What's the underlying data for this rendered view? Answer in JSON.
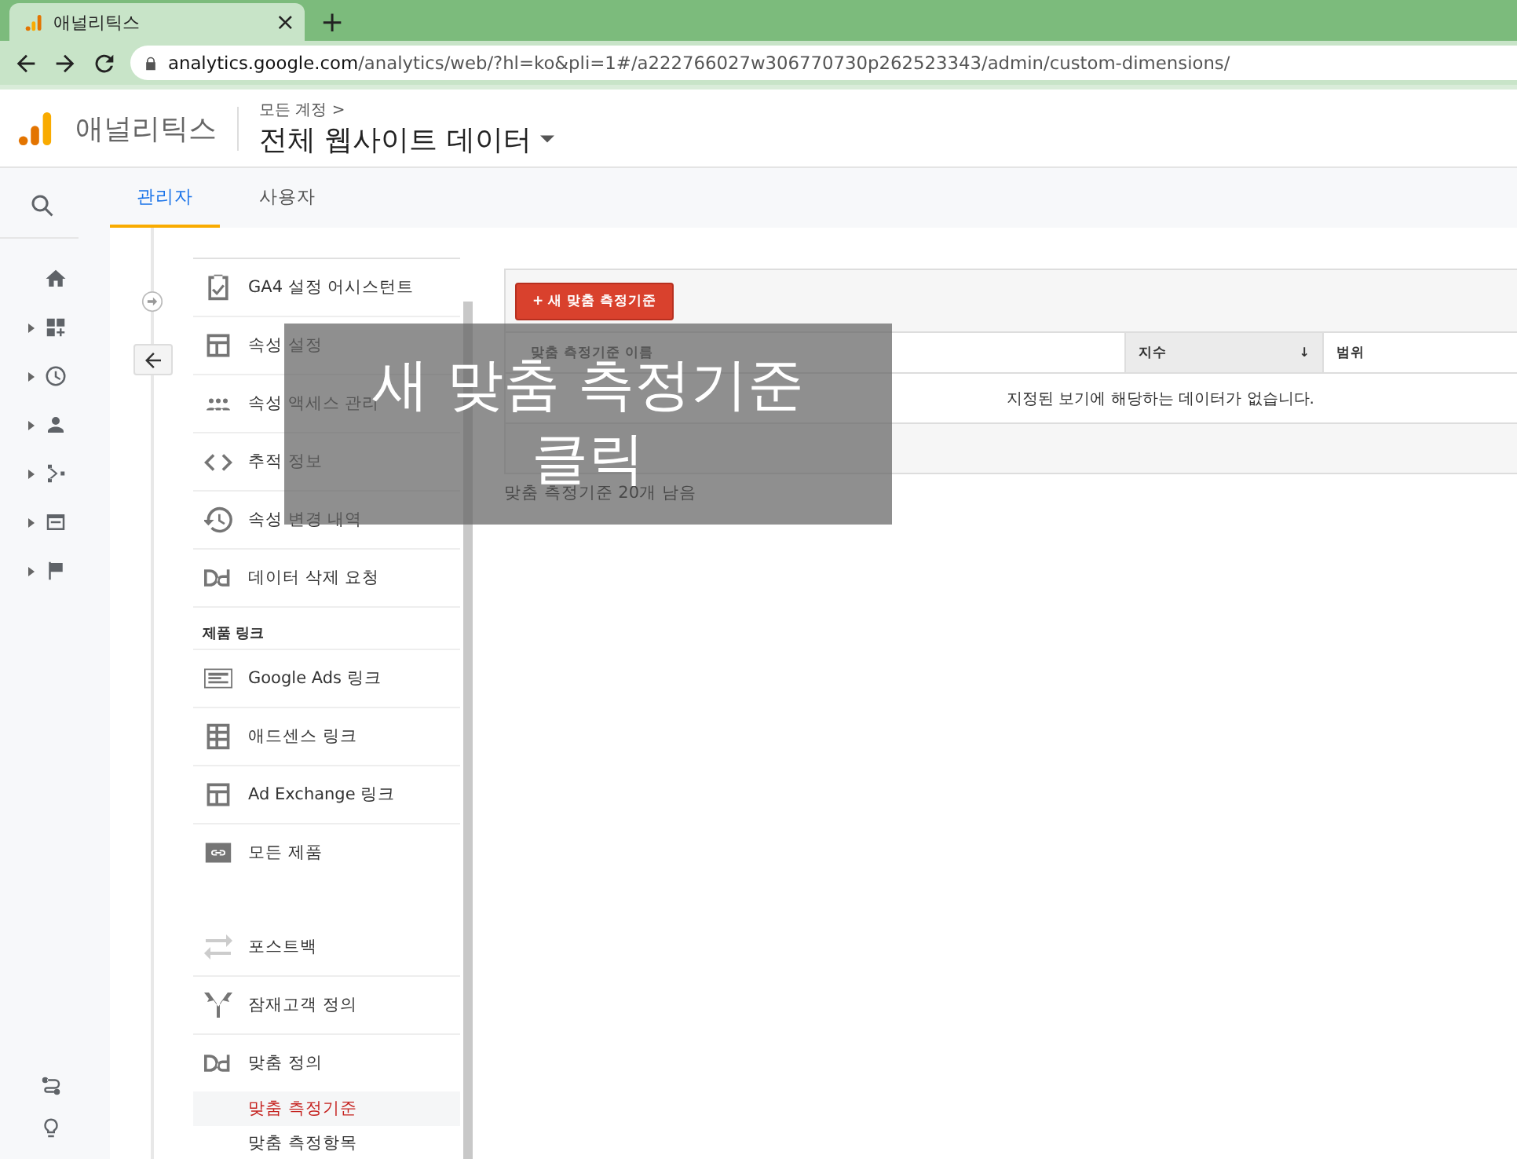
{
  "browser": {
    "tab_title": "애널리틱스",
    "close_mark": "×",
    "new_tab_mark": "+",
    "url_host": "analytics.google.com",
    "url_path": "/analytics/web/?hl=ko&pli=1#/a222766027w306770730p262523343/admin/custom-dimensions/"
  },
  "header": {
    "product": "애널리틱스",
    "breadcrumb": "모든 계정 >",
    "property": "전체 웹사이트 데이터"
  },
  "tabs": [
    {
      "label": "관리자",
      "selected": true
    },
    {
      "label": "사용자",
      "selected": false
    }
  ],
  "rail_items": [
    {
      "expandable": false
    },
    {
      "expandable": true
    },
    {
      "expandable": true
    },
    {
      "expandable": true
    },
    {
      "expandable": true
    },
    {
      "expandable": true
    },
    {
      "expandable": true
    }
  ],
  "menu_groups": [
    {
      "items": [
        {
          "label": "GA4 설정 어시스턴트"
        },
        {
          "label": "속성 설정"
        },
        {
          "label": "속성 액세스 관리"
        },
        {
          "label": "추적 정보"
        },
        {
          "label": "속성 변경 내역"
        },
        {
          "label": "데이터 삭제 요청"
        }
      ]
    },
    {
      "heading": "제품 링크",
      "items": [
        {
          "label": "Google Ads 링크"
        },
        {
          "label": "애드센스 링크"
        },
        {
          "label": "Ad Exchange 링크"
        },
        {
          "label": "모든 제품"
        }
      ]
    },
    {
      "items": [
        {
          "label": "포스트백"
        },
        {
          "label": "잠재고객 정의"
        },
        {
          "label": "맞춤 정의",
          "children": [
            {
              "label": "맞춤 측정기준",
              "selected": true
            },
            {
              "label": "맞춤 측정항목",
              "selected": false
            }
          ]
        }
      ]
    }
  ],
  "content": {
    "new_button": "+ 새 맞춤 측정기준",
    "columns": [
      {
        "label": "맞춤 측정기준 이름",
        "sorted": false
      },
      {
        "label": "지수",
        "sorted": true,
        "sort_mark": "↓"
      },
      {
        "label": "범위",
        "sorted": false
      }
    ],
    "empty_message": "지정된 보기에 해당하는 데이터가 없습니다.",
    "remaining": "맞춤 측정기준 20개 남음"
  },
  "callout": {
    "lines": [
      "새 맞춤 측정기준",
      "클릭"
    ]
  }
}
